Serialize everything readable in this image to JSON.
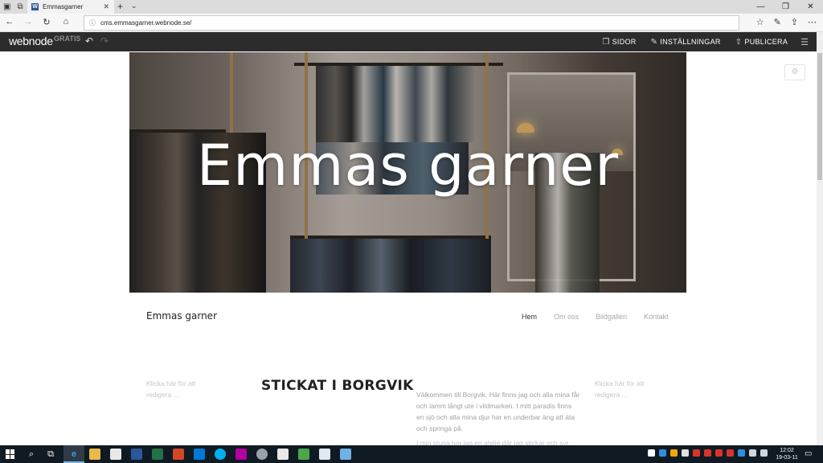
{
  "browser": {
    "tab_title": "Emmasgarner",
    "tab_favicon": "W",
    "url": "cms.emmasgarner.webnode.se/"
  },
  "editor_toolbar": {
    "logo": "webnode",
    "plan_badge": "GRATIS",
    "pages_label": "SIDOR",
    "settings_label": "INSTÄLLNINGAR",
    "publish_label": "PUBLICERA"
  },
  "hero": {
    "title": "Emmas garner"
  },
  "site_header": {
    "site_name": "Emmas garner",
    "nav": [
      "Hem",
      "Om oss",
      "Bildgalleri",
      "Kontakt"
    ]
  },
  "content": {
    "placeholder_left": "Klicka här för att redigera ...",
    "placeholder_right": "Klicka här för att redigera ...",
    "heading": "STICKAT I BORGVIK",
    "paragraph": "Välkommen till Borgvik. Här finns jag och alla mina får och lamm långt ute i vildmarken. I mitt paradis finns en sjö och alla mina djur har en underbar äng att äta och springa på.",
    "paragraph2": "I min stuga har jag en ateljé där jag stickar och syr"
  },
  "taskbar": {
    "time": "12:02",
    "date": "19-03-11"
  },
  "icons": {
    "back": "arrow-left-icon",
    "forward": "arrow-right-icon",
    "refresh": "refresh-icon",
    "home": "home-icon",
    "favorites": "star-icon",
    "notes": "pen-icon",
    "share": "share-icon",
    "more": "more-icon",
    "undo": "undo-icon",
    "redo": "redo-icon",
    "pages": "pages-icon",
    "settings": "wrench-icon",
    "publish": "upload-icon",
    "menu": "hamburger-icon",
    "gear": "gear-icon"
  },
  "colors": {
    "toolbar_bg": "#2c2c2c",
    "taskbar_bg": "#101a22",
    "placeholder_text": "#c6c6c6"
  }
}
